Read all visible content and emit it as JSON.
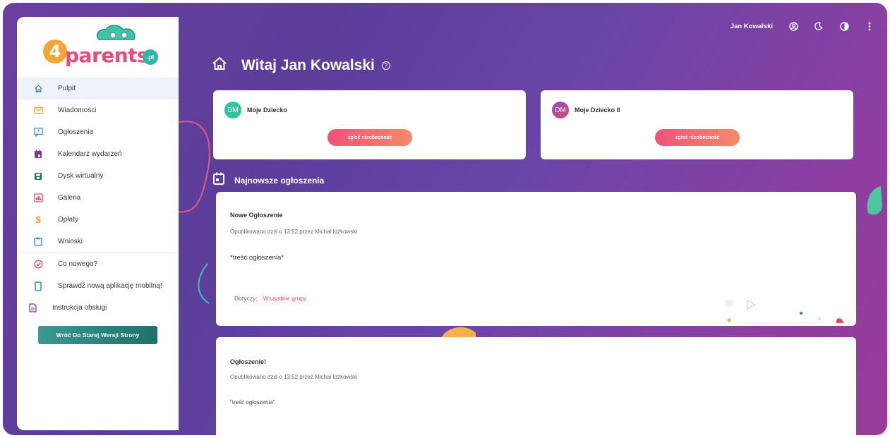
{
  "brand": {
    "logo_text": "parents",
    "logo_digit": "4",
    "logo_tld": ".pl"
  },
  "topbar": {
    "user_name": "Jan Kowalski"
  },
  "page": {
    "title": "Witaj Jan Kowalski"
  },
  "sidebar": {
    "items": [
      {
        "label": "Pulpit",
        "icon": "home-icon",
        "color": "#2f86c8"
      },
      {
        "label": "Wiadomości",
        "icon": "envelope-icon",
        "color": "#f2a23c"
      },
      {
        "label": "Ogłoszenia",
        "icon": "announcement-icon",
        "color": "#2f86c8"
      },
      {
        "label": "Kalendarz wydarzeń",
        "icon": "calendar-icon",
        "color": "#7a3f8a"
      },
      {
        "label": "Dysk wirtualny",
        "icon": "disk-icon",
        "color": "#1f6f6a"
      },
      {
        "label": "Galeria",
        "icon": "gallery-icon",
        "color": "#e0476a"
      },
      {
        "label": "Opłaty",
        "icon": "dollar-icon",
        "color": "#f2a23c"
      },
      {
        "label": "Wnioski",
        "icon": "clipboard-icon",
        "color": "#2f86c8"
      }
    ],
    "extra_items": [
      {
        "label": "Co nowego?",
        "icon": "check-circle-icon",
        "color": "#e0476a"
      },
      {
        "label": "Sprawdź nową aplikację mobilną!",
        "icon": "phone-icon",
        "color": "#2fa088"
      },
      {
        "label": "Instrukcja obsługi",
        "icon": "document-icon",
        "color": "#7a3f8a"
      }
    ],
    "old_version_button": "Wróć Do Starej Wersji Strony"
  },
  "children": [
    {
      "initials": "DM",
      "name": "Moje Dziecko",
      "avatar_color": "#2fc4a2",
      "button": "zgłoś nieobecność"
    },
    {
      "initials": "DM",
      "name": "Moje Dziecko II",
      "avatar_color": "#8a4fc8",
      "button": "zgłoś nieobecność"
    }
  ],
  "announcements_section": {
    "title": "Najnowsze ogłoszenia"
  },
  "announcements": [
    {
      "title": "Nowe Ogłoszenie",
      "meta": "Opublikowano dziś o 13:52 przez Michał Idźkowski",
      "body": "*treść ogłoszenia*",
      "groups_label": "Dotyczy:",
      "groups_value": "Wszystkie grupy"
    },
    {
      "title": "Ogłoszenie!",
      "meta": "Opublikowano dziś o 13:52 przez Michał Idźkowski",
      "body": "\"treść ogłoszenia\""
    }
  ]
}
